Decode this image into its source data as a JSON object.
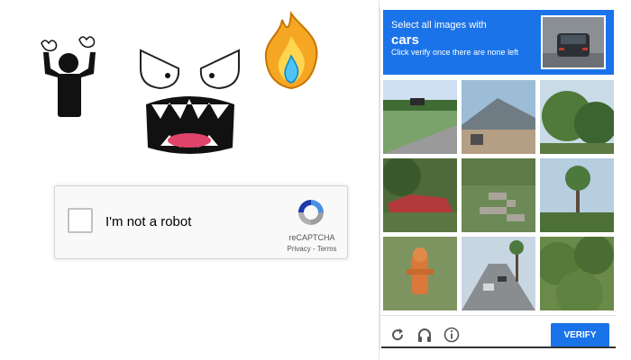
{
  "anchor": {
    "checkbox_label": "I'm not a robot",
    "brand": "reCAPTCHA",
    "privacy": "Privacy",
    "separator": " - ",
    "terms": "Terms"
  },
  "challenge": {
    "instruction": "Select all images with",
    "target": "cars",
    "hint": "Click verify once there are none left",
    "verify_label": "VERIFY",
    "tiles": [
      {
        "name": "tile-road-with-truck"
      },
      {
        "name": "tile-house-roof"
      },
      {
        "name": "tile-trees"
      },
      {
        "name": "tile-red-car-in-bushes"
      },
      {
        "name": "tile-stairs"
      },
      {
        "name": "tile-palm-trees"
      },
      {
        "name": "tile-fire-hydrant"
      },
      {
        "name": "tile-street-with-cars"
      },
      {
        "name": "tile-bushes"
      }
    ],
    "footer_icons": [
      "reload-icon",
      "headphones-icon",
      "info-icon"
    ]
  },
  "colors": {
    "accent": "#1a73e8",
    "header_text": "#ffffff"
  }
}
